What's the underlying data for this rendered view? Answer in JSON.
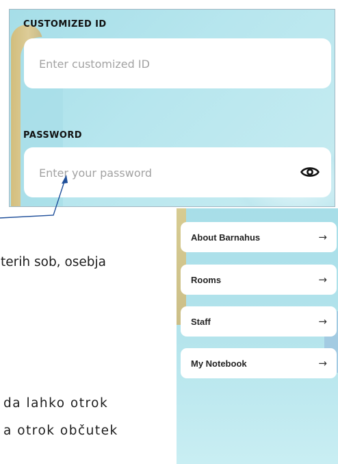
{
  "login": {
    "customized_id_label": "CUSTOMIZED ID",
    "customized_id_placeholder": "Enter customized ID",
    "password_label": "PASSWORD",
    "password_placeholder": "Enter your password",
    "show_password_icon": "eye-icon"
  },
  "document": {
    "lines": [
      "terih sob, osebja",
      "da lahko otrok",
      "a otrok občutek"
    ]
  },
  "menu": {
    "items": [
      {
        "label": "About Barnahus",
        "icon": "arrow-right-icon",
        "arrow": "→"
      },
      {
        "label": "Rooms",
        "icon": "arrow-right-icon",
        "arrow": "→"
      },
      {
        "label": "Staff",
        "icon": "arrow-right-icon",
        "arrow": "→"
      },
      {
        "label": "My Notebook",
        "icon": "arrow-right-icon",
        "arrow": "→"
      }
    ]
  },
  "colors": {
    "app_background": "#a9dfe9",
    "callout_line": "#1f4f9a",
    "field_background": "#ffffff"
  }
}
